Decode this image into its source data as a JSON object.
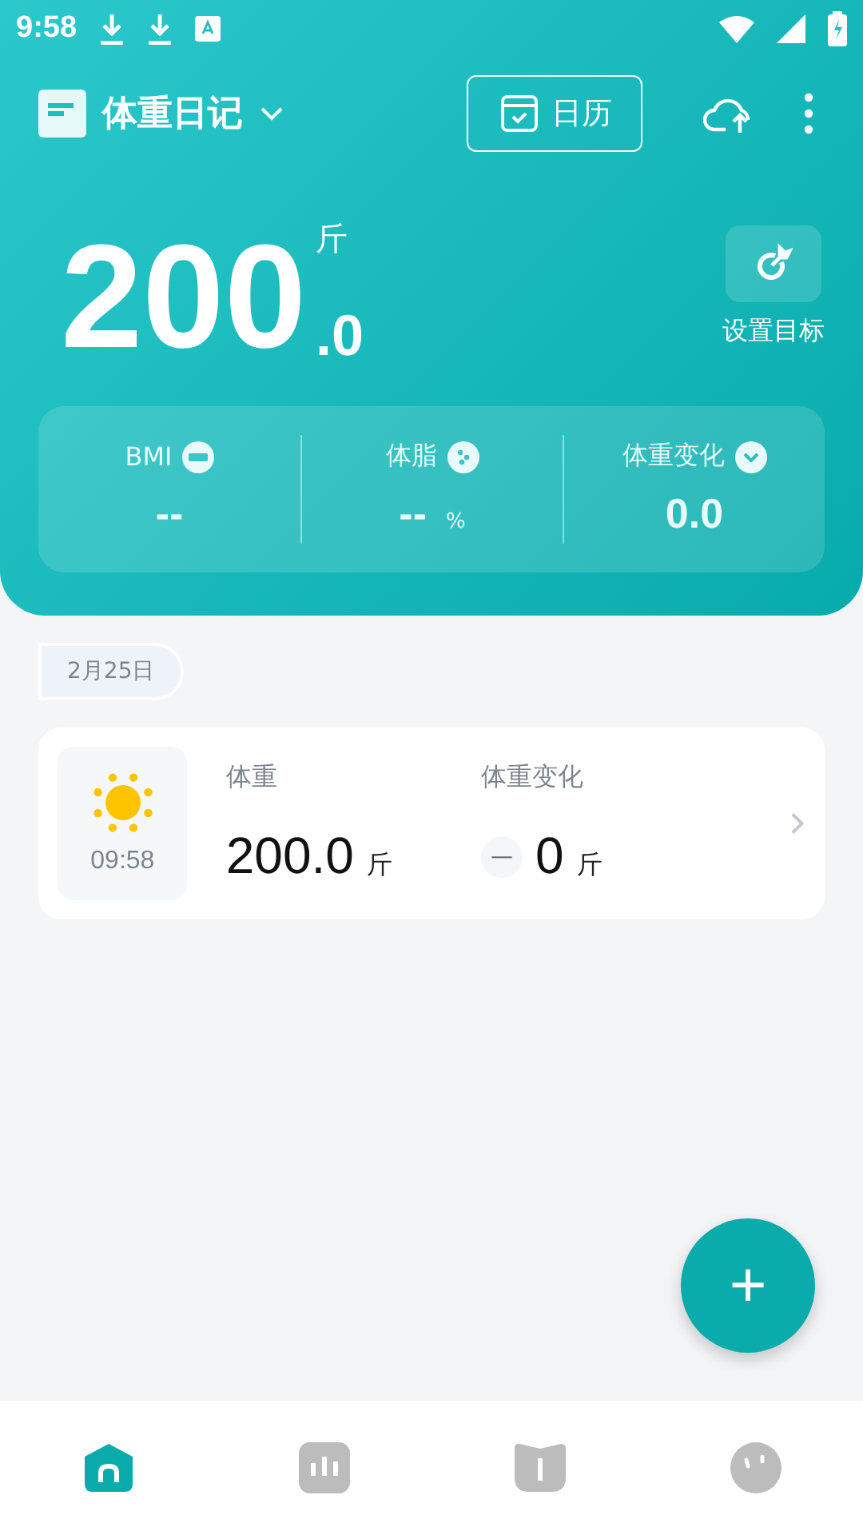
{
  "status_bar": {
    "time": "9:58"
  },
  "header": {
    "title": "体重日记",
    "calendar_button": "日历",
    "weight_integer": "200",
    "weight_decimal": ".0",
    "unit": "斤",
    "goal_label": "设置目标"
  },
  "stats": [
    {
      "kind": "bmi",
      "label": "BMI",
      "value": "--"
    },
    {
      "kind": "fat",
      "label": "体脂",
      "value": "--",
      "unit": "%"
    },
    {
      "kind": "change",
      "label": "体重变化",
      "value": "0.0"
    }
  ],
  "date_chip": "2月25日",
  "records": [
    {
      "time": "09:58",
      "weight_label": "体重",
      "weight": "200.0",
      "weight_unit": "斤",
      "change_label": "体重变化",
      "change_sign": "—",
      "change": "0",
      "change_unit": "斤"
    }
  ],
  "fab": "+",
  "nav": [
    {
      "kind": "home",
      "selected": true
    },
    {
      "kind": "chart",
      "selected": false
    },
    {
      "kind": "badge",
      "selected": false
    },
    {
      "kind": "face",
      "selected": false
    }
  ]
}
